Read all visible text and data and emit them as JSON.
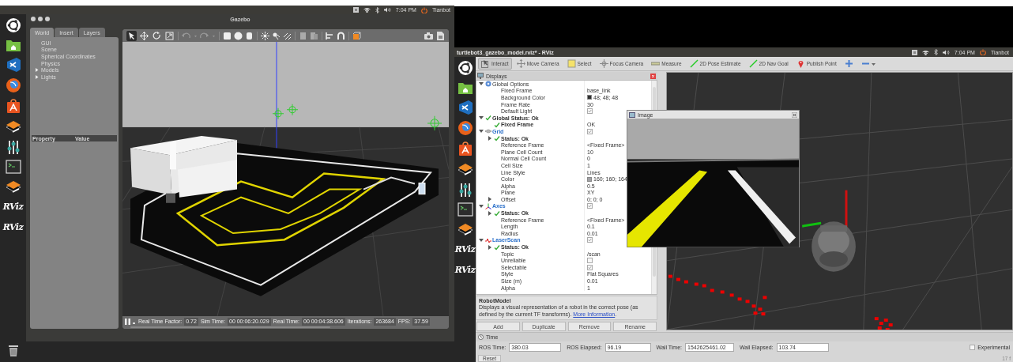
{
  "left_screen": {
    "top_panel": {
      "time": "7:04 PM",
      "user": "Tianbot"
    },
    "launcher": [
      {
        "kind": "ubuntu"
      },
      {
        "kind": "folder"
      },
      {
        "kind": "editor"
      },
      {
        "kind": "browser"
      },
      {
        "kind": "store"
      },
      {
        "kind": "stack"
      },
      {
        "kind": "mixer"
      },
      {
        "kind": "terminal"
      },
      {
        "kind": "stack"
      },
      {
        "kind": "rviz",
        "label": "RViz"
      },
      {
        "kind": "rviz",
        "label": "RViz"
      },
      {
        "kind": "trash"
      }
    ],
    "window": {
      "title": "Gazebo"
    },
    "tabs": [
      {
        "label": "World",
        "selected": true
      },
      {
        "label": "Insert",
        "selected": false
      },
      {
        "label": "Layers",
        "selected": false
      }
    ],
    "world_tree": [
      {
        "label": "GUI"
      },
      {
        "label": "Scene"
      },
      {
        "label": "Spherical Coordinates"
      },
      {
        "label": "Physics"
      },
      {
        "label": "Models",
        "expanded": false
      },
      {
        "label": "Lights",
        "expanded": false
      }
    ],
    "property_table": {
      "columns": [
        "Property",
        "Value"
      ]
    },
    "tools": [
      {
        "kind": "select",
        "selected": true
      },
      {
        "kind": "translate",
        "selected": false
      },
      {
        "kind": "rotate",
        "selected": false
      },
      {
        "kind": "scale",
        "selected": false
      }
    ],
    "status_bar": [
      {
        "label": "Real Time Factor:",
        "value": "0.72"
      },
      {
        "label": "Sim Time:",
        "value": "00 00:06:20.029"
      },
      {
        "label": "Real Time:",
        "value": "00 00:04:38.606"
      },
      {
        "label": "Iterations:",
        "value": "263684"
      },
      {
        "label": "FPS:",
        "value": "37.59"
      }
    ]
  },
  "right_screen": {
    "top_panel": {
      "title": "turtlebot3_gazebo_model.rviz* - RViz",
      "time": "7:04 PM",
      "user": "Tianbot"
    },
    "launcher": [
      {
        "kind": "ubuntu"
      },
      {
        "kind": "folder"
      },
      {
        "kind": "editor"
      },
      {
        "kind": "browser"
      },
      {
        "kind": "store"
      },
      {
        "kind": "stack"
      },
      {
        "kind": "mixer"
      },
      {
        "kind": "terminal"
      },
      {
        "kind": "stack"
      },
      {
        "kind": "rviz",
        "label": "RViz"
      },
      {
        "kind": "rviz",
        "label": "RViz"
      }
    ],
    "toolbar": [
      {
        "kind": "interact",
        "label": "Interact",
        "selected": true
      },
      {
        "kind": "move",
        "label": "Move Camera",
        "selected": false
      },
      {
        "kind": "select",
        "label": "Select",
        "selected": false
      },
      {
        "kind": "focus",
        "label": "Focus Camera",
        "selected": false
      },
      {
        "kind": "measure",
        "label": "Measure",
        "selected": false
      },
      {
        "kind": "pose",
        "label": "2D Pose Estimate",
        "selected": false
      },
      {
        "kind": "goal",
        "label": "2D Nav Goal",
        "selected": false
      },
      {
        "kind": "point",
        "label": "Publish Point",
        "selected": false
      },
      {
        "kind": "add",
        "selected": false
      },
      {
        "kind": "remove",
        "selected": false
      }
    ],
    "displays": {
      "title": "Displays",
      "tree": [
        {
          "kind": "global",
          "label": "Global Options",
          "expanded": true,
          "children": [
            {
              "kind": "property",
              "label": "Fixed Frame",
              "value": "base_link"
            },
            {
              "kind": "property",
              "label": "Background Color",
              "value": "48; 48; 48",
              "color": "#303030"
            },
            {
              "kind": "property",
              "label": "Frame Rate",
              "value": "30"
            },
            {
              "kind": "property",
              "label": "Default Light",
              "checked": true
            }
          ]
        },
        {
          "kind": "status",
          "label": "Global Status: Ok",
          "expanded": true,
          "children": [
            {
              "kind": "status",
              "label": "Fixed Frame",
              "value": "OK"
            }
          ]
        },
        {
          "kind": "grid",
          "label": "Grid",
          "expanded": true,
          "checked": true,
          "children": [
            {
              "kind": "status",
              "label": "Status: Ok",
              "expanded": false
            },
            {
              "kind": "property",
              "label": "Reference Frame",
              "value": "<Fixed Frame>"
            },
            {
              "kind": "property",
              "label": "Plane Cell Count",
              "value": "10"
            },
            {
              "kind": "property",
              "label": "Normal Cell Count",
              "value": "0"
            },
            {
              "kind": "property",
              "label": "Cell Size",
              "value": "1"
            },
            {
              "kind": "property",
              "label": "Line Style",
              "value": "Lines"
            },
            {
              "kind": "property",
              "label": "Color",
              "value": "160; 160; 164",
              "color": "#a0a0a4"
            },
            {
              "kind": "property",
              "label": "Alpha",
              "value": "0.5"
            },
            {
              "kind": "property",
              "label": "Plane",
              "value": "XY"
            },
            {
              "kind": "property",
              "label": "Offset",
              "value": "0; 0; 0",
              "expanded": false
            }
          ]
        },
        {
          "kind": "axes",
          "label": "Axes",
          "expanded": true,
          "checked": true,
          "children": [
            {
              "kind": "status",
              "label": "Status: Ok",
              "expanded": false
            },
            {
              "kind": "property",
              "label": "Reference Frame",
              "value": "<Fixed Frame>"
            },
            {
              "kind": "property",
              "label": "Length",
              "value": "0.1"
            },
            {
              "kind": "property",
              "label": "Radius",
              "value": "0.01"
            }
          ]
        },
        {
          "kind": "laser",
          "label": "LaserScan",
          "expanded": true,
          "checked": true,
          "children": [
            {
              "kind": "status",
              "label": "Status: Ok",
              "expanded": false
            },
            {
              "kind": "property",
              "label": "Topic",
              "value": "/scan"
            },
            {
              "kind": "property",
              "label": "Unreliable",
              "checked": false
            },
            {
              "kind": "property",
              "label": "Selectable",
              "checked": true
            },
            {
              "kind": "property",
              "label": "Style",
              "value": "Flat Squares"
            },
            {
              "kind": "property",
              "label": "Size (m)",
              "value": "0.01"
            },
            {
              "kind": "property",
              "label": "Alpha",
              "value": "1"
            }
          ]
        }
      ],
      "description": {
        "title": "RobotModel",
        "text": "Displays a visual representation of a robot in the correct pose (as defined by the current TF transforms). ",
        "link": "More Information",
        "after": "."
      },
      "buttons": [
        "Add",
        "Duplicate",
        "Remove",
        "Rename"
      ]
    },
    "image_window": {
      "title": "Image"
    },
    "time_panel": {
      "title": "Time",
      "fields": [
        {
          "label": "ROS Time:",
          "value": "380.03"
        },
        {
          "label": "ROS Elapsed:",
          "value": "96.19"
        },
        {
          "label": "Wall Time:",
          "value": "1542625461.02"
        },
        {
          "label": "Wall Elapsed:",
          "value": "103.74"
        }
      ],
      "experimental": {
        "label": "Experimental",
        "checked": false
      },
      "reset": "Reset",
      "fps": "17 f"
    }
  }
}
